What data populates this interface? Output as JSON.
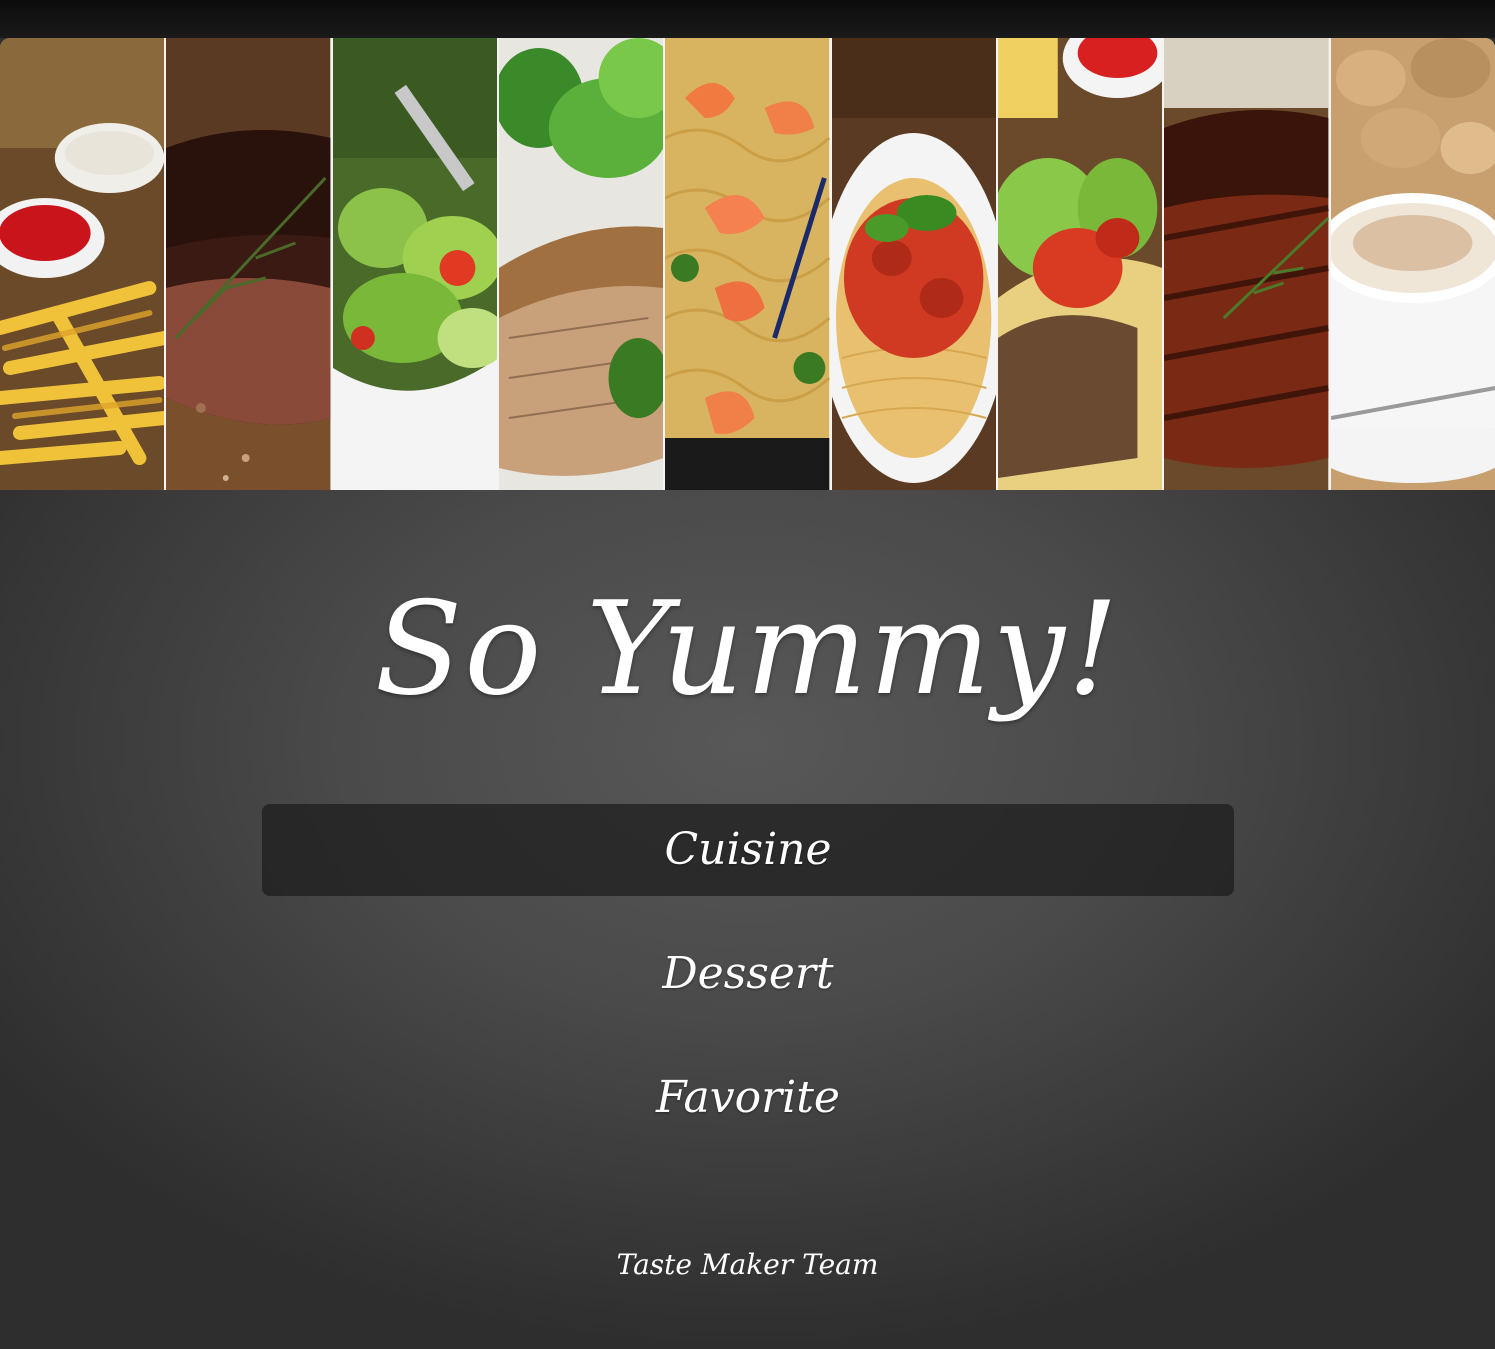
{
  "banner": {
    "panels": [
      {
        "name": "fries-panel"
      },
      {
        "name": "steak-panel"
      },
      {
        "name": "salad-panel"
      },
      {
        "name": "salmon-panel"
      },
      {
        "name": "shrimp-noodles-panel"
      },
      {
        "name": "spaghetti-panel"
      },
      {
        "name": "tacos-panel"
      },
      {
        "name": "grilled-chicken-panel"
      },
      {
        "name": "cappuccino-panel"
      }
    ]
  },
  "header": {
    "title": "So Yummy!"
  },
  "menu": {
    "items": [
      {
        "label": "Cuisine",
        "active": true
      },
      {
        "label": "Dessert",
        "active": false
      },
      {
        "label": "Favorite",
        "active": false
      }
    ]
  },
  "footer": {
    "text": "Taste Maker Team"
  },
  "colors": {
    "background": "#4a4a4a",
    "text": "#ffffff",
    "active_item_bg": "#1c1c1c"
  }
}
